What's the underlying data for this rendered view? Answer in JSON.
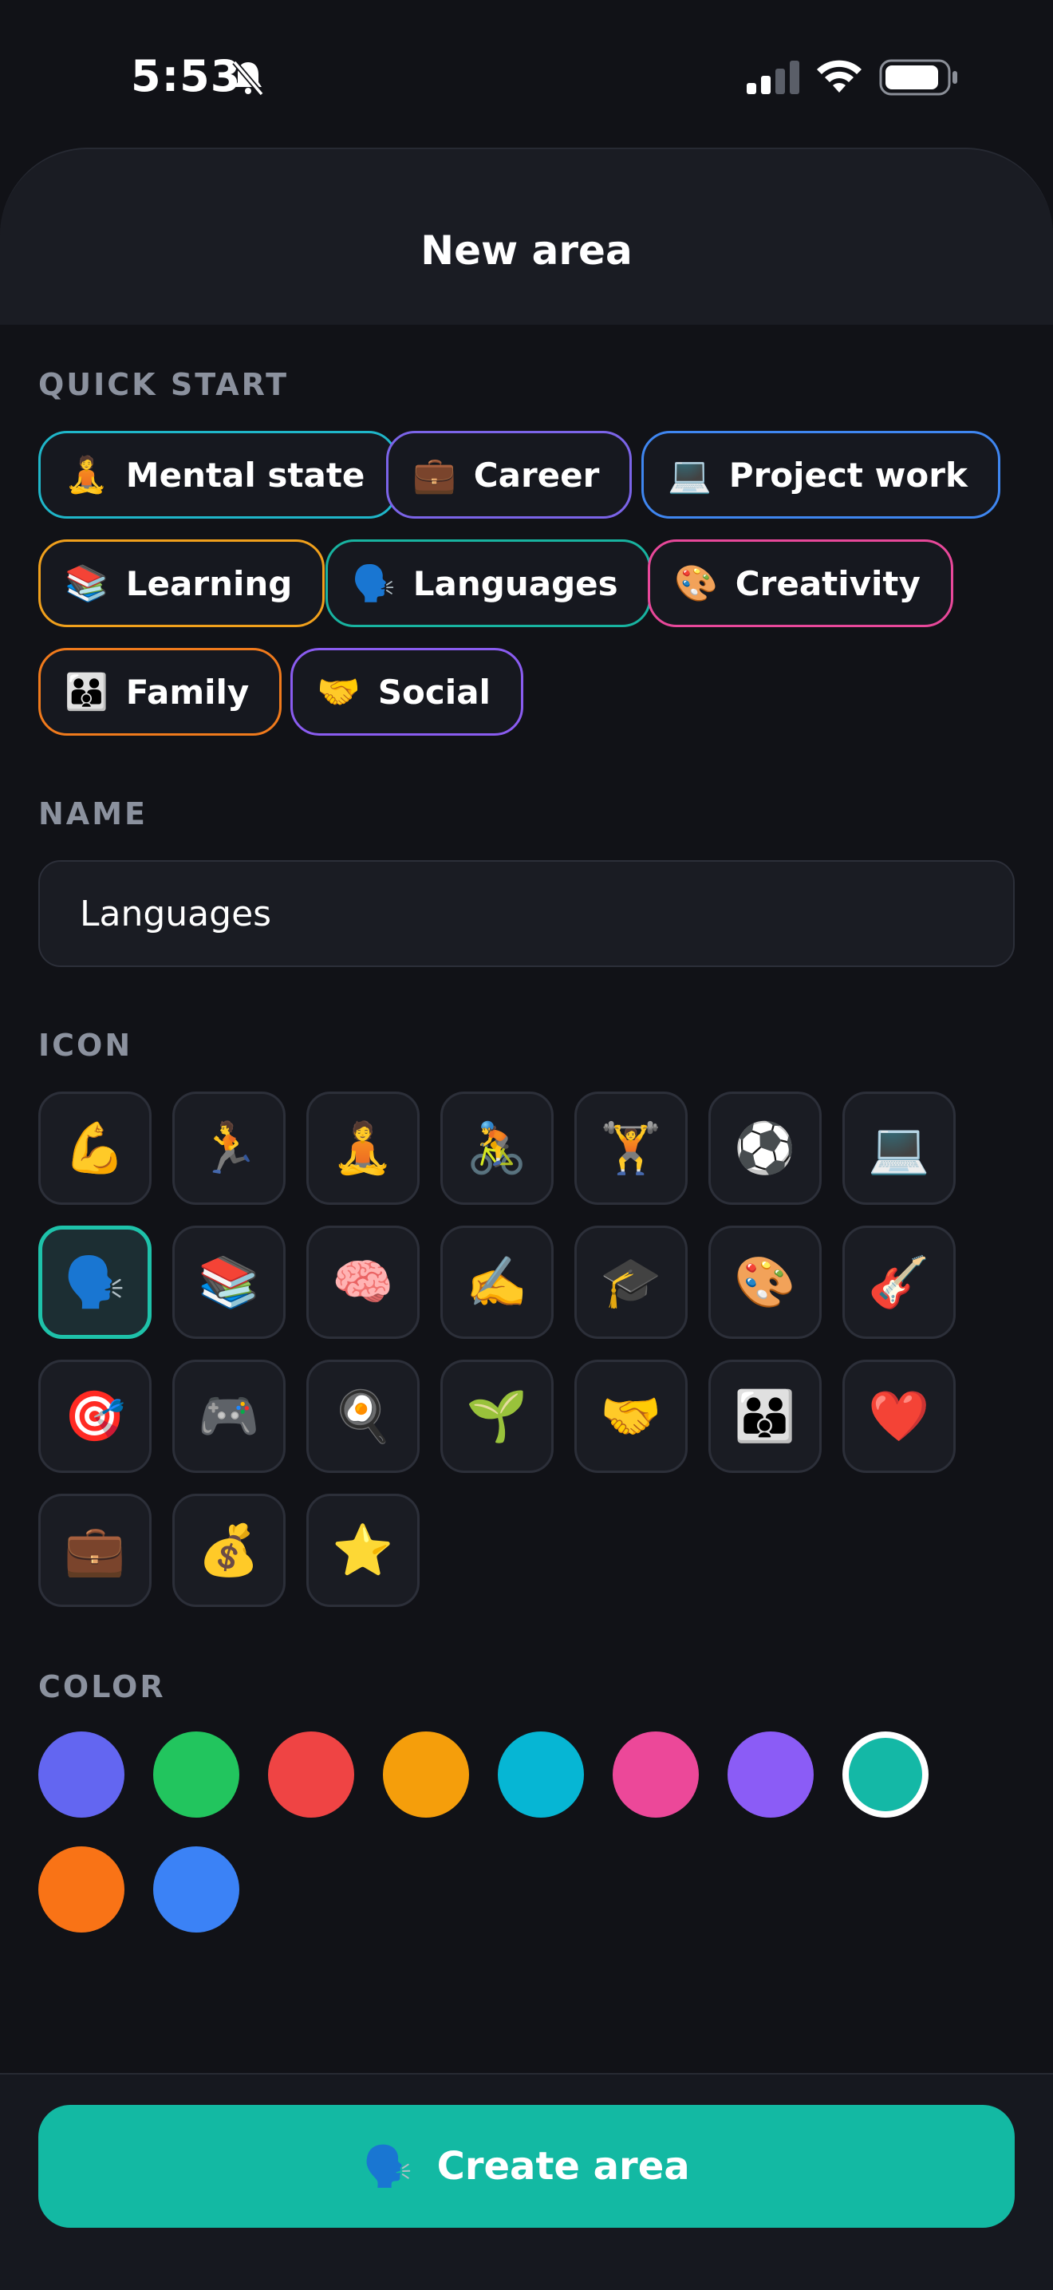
{
  "status_bar": {
    "time": "5:53"
  },
  "header": {
    "title": "New area"
  },
  "quick_start": {
    "label": "QUICK START",
    "chips": [
      {
        "emoji": "🧘",
        "label": "Mental state",
        "color": "#1fb6c9"
      },
      {
        "emoji": "💼",
        "label": "Career",
        "color": "#7b64e8"
      },
      {
        "emoji": "💻",
        "label": "Project work",
        "color": "#3f86f0"
      },
      {
        "emoji": "📚",
        "label": "Learning",
        "color": "#f0a01c"
      },
      {
        "emoji": "🗣️",
        "label": "Languages",
        "color": "#18b3a0"
      },
      {
        "emoji": "🎨",
        "label": "Creativity",
        "color": "#e8489a"
      },
      {
        "emoji": "👪",
        "label": "Family",
        "color": "#f07a1c"
      },
      {
        "emoji": "🤝",
        "label": "Social",
        "color": "#8a5cf0"
      }
    ]
  },
  "name": {
    "label": "NAME",
    "value": "Languages"
  },
  "icon": {
    "label": "ICON",
    "selected_index": 7,
    "options": [
      "💪",
      "🏃",
      "🧘",
      "🚴",
      "🏋️",
      "⚽",
      "💻",
      "🗣️",
      "📚",
      "🧠",
      "✍️",
      "🎓",
      "🎨",
      "🎸",
      "🎯",
      "🎮",
      "🍳",
      "🌱",
      "🤝",
      "👪",
      "❤️",
      "💼",
      "💰",
      "⭐"
    ]
  },
  "color": {
    "label": "COLOR",
    "selected_index": 7,
    "options": [
      "#6366f1",
      "#22c55e",
      "#ef4444",
      "#f59e0b",
      "#06b6d4",
      "#ec4899",
      "#8b5cf6",
      "#14b8a6",
      "#f97316",
      "#3b82f6"
    ]
  },
  "footer": {
    "button_emoji": "🗣️",
    "button_label": "Create area"
  }
}
